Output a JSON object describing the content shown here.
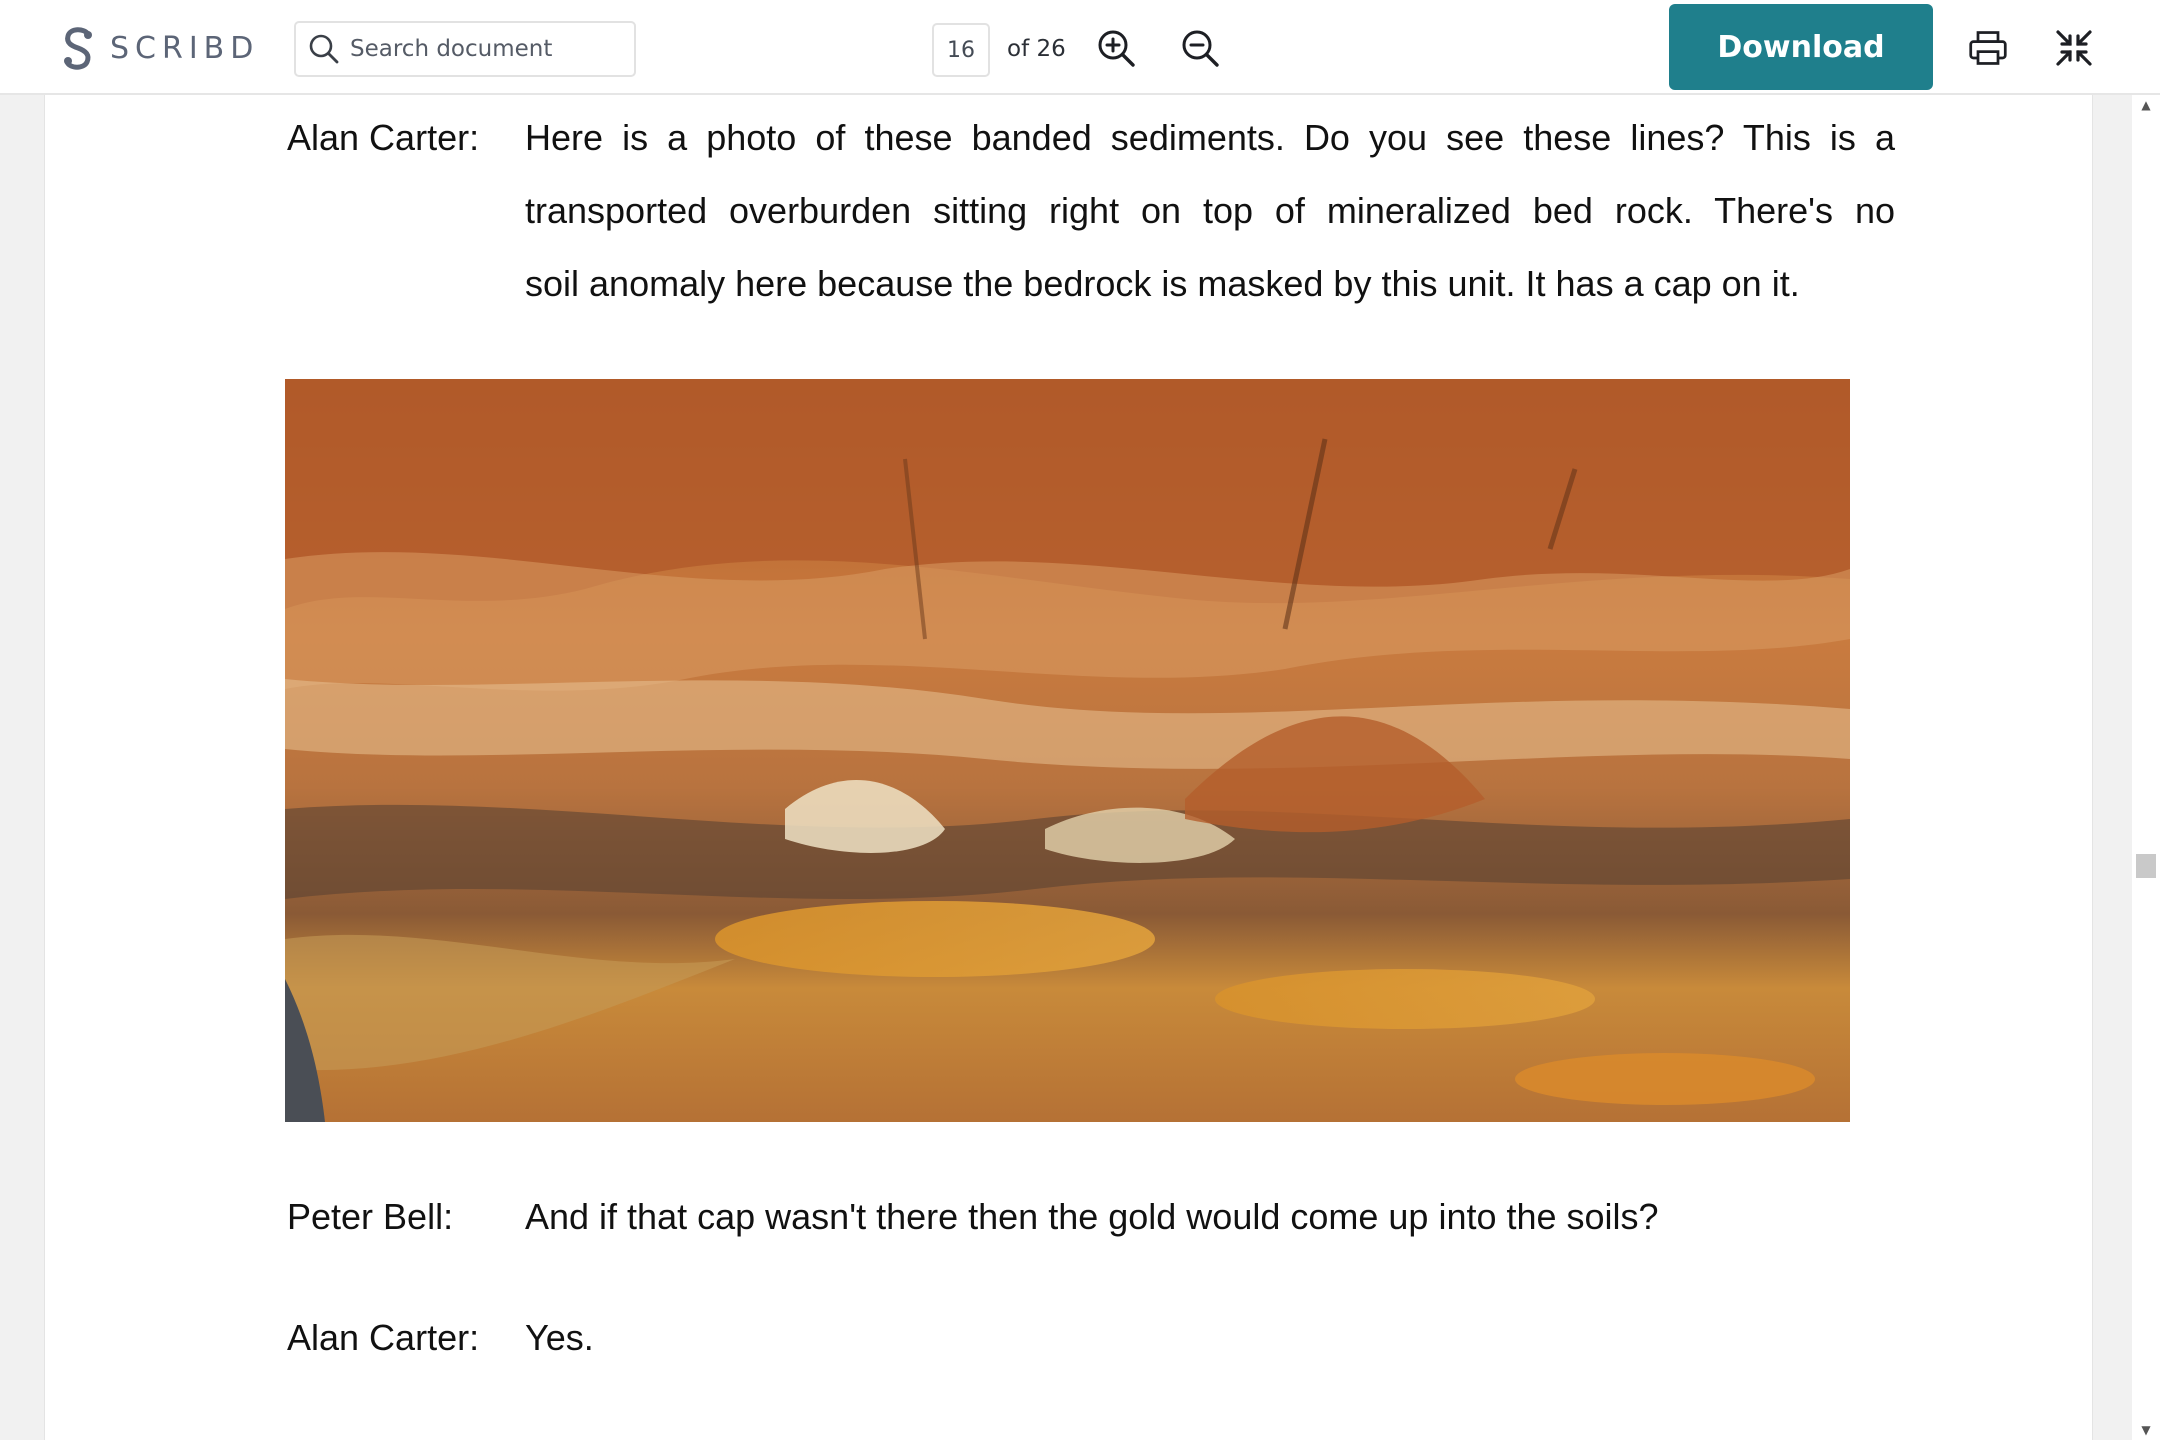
{
  "toolbar": {
    "logo_text": "SCRIBD",
    "search_placeholder": "Search document",
    "current_page": "16",
    "page_total_label": "of 26",
    "download_label": "Download",
    "accent_color": "#1f7f8c"
  },
  "icons": {
    "logo": "scribd-logo-icon",
    "search": "search-icon",
    "zoom_in": "zoom-in-icon",
    "zoom_out": "zoom-out-icon",
    "print": "printer-icon",
    "collapse": "collapse-fullscreen-icon"
  },
  "document": {
    "blocks": [
      {
        "speaker": "Alan Carter:",
        "lines": [
          "Here is a photo of these banded sediments. Do you see these lines? This is a",
          "transported overburden sitting right on top of mineralized bed rock. There's no",
          "soil anomaly here because the bedrock is masked by this unit. It has a cap on it."
        ]
      },
      {
        "speaker": "Peter Bell:",
        "lines": [
          "And if that cap wasn't there then the gold would come up into the soils?"
        ]
      },
      {
        "speaker": "Alan Carter:",
        "lines": [
          "Yes."
        ]
      }
    ]
  }
}
